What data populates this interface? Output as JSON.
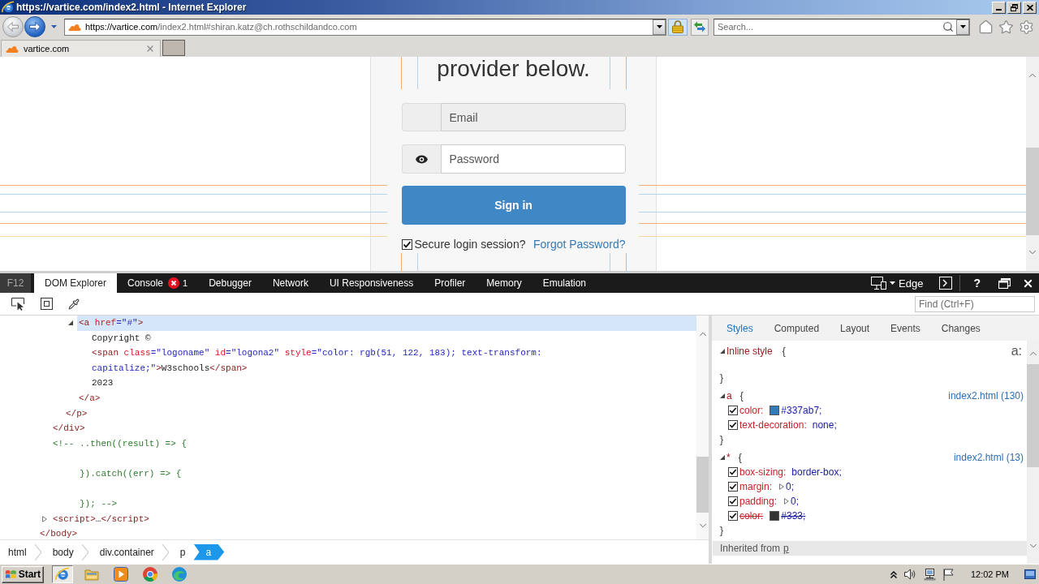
{
  "window": {
    "title": "https://vartice.com/index2.html - Internet Explorer"
  },
  "address_bar": {
    "url_host": "https://vartice.com",
    "url_path": "/index2.html#shiran.katz@ch.rothschildandco.com"
  },
  "search": {
    "placeholder": "Search..."
  },
  "tabs": [
    {
      "label": "vartice.com",
      "selected": true
    }
  ],
  "page": {
    "heading": "provider below.",
    "email": {
      "placeholder": "Email",
      "disabled": true
    },
    "password": {
      "placeholder": "Password",
      "disabled": false
    },
    "submit": "Sign in",
    "remember": {
      "label": "Secure login session?",
      "checked": true
    },
    "forgot_link": "Forgot Password?"
  },
  "devtools": {
    "f12": "F12",
    "tabs": [
      {
        "label": "DOM Explorer",
        "selected": true
      },
      {
        "label": "Console",
        "selected": false,
        "error_count": "1"
      },
      {
        "label": "Debugger",
        "selected": false
      },
      {
        "label": "Network",
        "selected": false
      },
      {
        "label": "UI Responsiveness",
        "selected": false
      },
      {
        "label": "Profiler",
        "selected": false
      },
      {
        "label": "Memory",
        "selected": false
      },
      {
        "label": "Emulation",
        "selected": false
      }
    ],
    "document_mode": "Edge",
    "help": "?",
    "find": {
      "placeholder": "Find (Ctrl+F)"
    },
    "dom_tree": [
      {
        "kind": "element",
        "selected": false,
        "children": [
          {
            "kind": "element",
            "selected": false,
            "children": [
              {
                "kind": "element",
                "selected": false,
                "children": [
                  {
                    "kind": "element",
                    "selected": true,
                    "expanded": true,
                    "open": [
                      {
                        "kind": "tag",
                        "text": "<a"
                      },
                      {
                        "kind": "attr",
                        "text": " href"
                      },
                      {
                        "kind": "value",
                        "text": "=\"#\""
                      },
                      {
                        "kind": "tag",
                        "text": ">"
                      }
                    ],
                    "children": [
                      {
                        "kind": "text",
                        "selected": false,
                        "text": "Copyright ©"
                      },
                      {
                        "kind": "element",
                        "selected": false,
                        "open": [
                          {
                            "kind": "tag",
                            "text": "<span"
                          },
                          {
                            "kind": "attr",
                            "text": " class"
                          },
                          {
                            "kind": "value",
                            "text": "=\"logoname\""
                          },
                          {
                            "kind": "attr",
                            "text": " id"
                          },
                          {
                            "kind": "value",
                            "text": "=\"logona2\""
                          },
                          {
                            "kind": "attr",
                            "text": " style"
                          },
                          {
                            "kind": "value",
                            "text": "=\"color: rgb(51, 122, 183); text-transform: capitalize;\""
                          },
                          {
                            "kind": "tag",
                            "text": ">"
                          },
                          {
                            "kind": "text",
                            "text": "W3schools"
                          },
                          {
                            "kind": "tag",
                            "text": "</span>"
                          }
                        ]
                      },
                      {
                        "kind": "text",
                        "selected": false,
                        "text": "2023"
                      }
                    ],
                    "close": [
                      {
                        "kind": "tag",
                        "text": "</a>"
                      }
                    ]
                  }
                ],
                "close": [
                  {
                    "kind": "tag",
                    "text": "</p>"
                  }
                ]
              }
            ],
            "close": [
              {
                "kind": "tag",
                "text": "</div>"
              }
            ]
          },
          {
            "kind": "comment",
            "selected": false,
            "text": "<!-- ..then((result) => {\n\n     }).catch((err) => {\n\n     }); -->"
          },
          {
            "kind": "element",
            "selected": false,
            "expanded": false,
            "open": [
              {
                "kind": "tag",
                "text": "<script>"
              },
              {
                "kind": "text",
                "text": "…"
              },
              {
                "kind": "tag",
                "text": "</script>"
              }
            ]
          }
        ],
        "close": [
          {
            "kind": "tag",
            "text": "</body>"
          }
        ]
      }
    ],
    "breadcrumb": [
      {
        "label": "html",
        "selected": false
      },
      {
        "label": "body",
        "selected": false
      },
      {
        "label": "div.container",
        "selected": false
      },
      {
        "label": "p",
        "selected": false
      },
      {
        "label": "a",
        "selected": true
      }
    ],
    "styles": {
      "tabs": [
        {
          "label": "Styles",
          "selected": true
        },
        {
          "label": "Computed",
          "selected": false
        },
        {
          "label": "Layout",
          "selected": false
        },
        {
          "label": "Events",
          "selected": false
        },
        {
          "label": "Changes",
          "selected": false
        }
      ],
      "pseudo_toggle": "a:",
      "rules": [
        {
          "kind": "inline",
          "selector": "Inline style",
          "open_brace": "{",
          "close_brace": "}",
          "expanded": true
        },
        {
          "kind": "rule",
          "selector": "a",
          "open_brace": "{",
          "source": "index2.html (130)",
          "expanded": true,
          "close_brace": "}",
          "properties": [
            {
              "name": "color:",
              "value": "#337ab7;",
              "color": "#337ab7",
              "checked": true,
              "overridden": false,
              "expandable": false
            },
            {
              "name": "text-decoration:",
              "value": "none;",
              "checked": true,
              "overridden": false,
              "expandable": false
            }
          ]
        },
        {
          "kind": "rule",
          "selector": "*",
          "open_brace": "{",
          "source": "index2.html (13)",
          "expanded": true,
          "close_brace": "}",
          "properties": [
            {
              "name": "box-sizing:",
              "value": "border-box;",
              "checked": true,
              "overridden": false,
              "expandable": false
            },
            {
              "name": "margin:",
              "value": "0;",
              "checked": true,
              "overridden": false,
              "expandable": true
            },
            {
              "name": "padding:",
              "value": "0;",
              "checked": true,
              "overridden": false,
              "expandable": true
            },
            {
              "name": "color:",
              "value": "#333;",
              "color": "#333333",
              "checked": true,
              "overridden": true,
              "expandable": false
            }
          ]
        }
      ],
      "inherited": {
        "label": "Inherited from",
        "link": "p"
      }
    }
  },
  "taskbar": {
    "start": "Start",
    "apps": [
      {
        "kind": "ie",
        "selected": true
      },
      {
        "kind": "explorer",
        "selected": false
      },
      {
        "kind": "media_player",
        "selected": false
      },
      {
        "kind": "chrome",
        "selected": false
      },
      {
        "kind": "edge",
        "selected": false
      }
    ],
    "clock": "12:02 PM"
  }
}
